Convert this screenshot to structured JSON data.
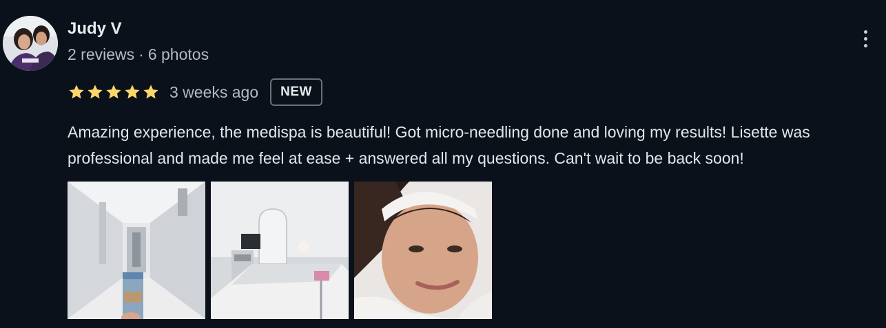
{
  "author": {
    "name": "Judy V",
    "reviews": "2 reviews",
    "separator": "·",
    "photos": "6 photos"
  },
  "rating": {
    "stars": 5,
    "max_stars": 5,
    "time_ago": "3 weeks ago",
    "badge": "NEW"
  },
  "review_text": "Amazing experience, the medispa is beautiful! Got micro-needling done and loving my results! Lisette was professional and made me feel at ease + answered all my questions. Can't wait to be back soon!",
  "photos": [
    {
      "subject": "hallway-with-coffee-cup"
    },
    {
      "subject": "treatment-room"
    },
    {
      "subject": "selfie-after-treatment"
    }
  ],
  "icons": {
    "more": "more-vert-icon",
    "star": "star-icon"
  },
  "colors": {
    "background": "#0a111b",
    "star": "#fbd66a",
    "text": "#e3e6ea",
    "meta_text": "#b5bac1",
    "badge_border": "#6b7178"
  }
}
